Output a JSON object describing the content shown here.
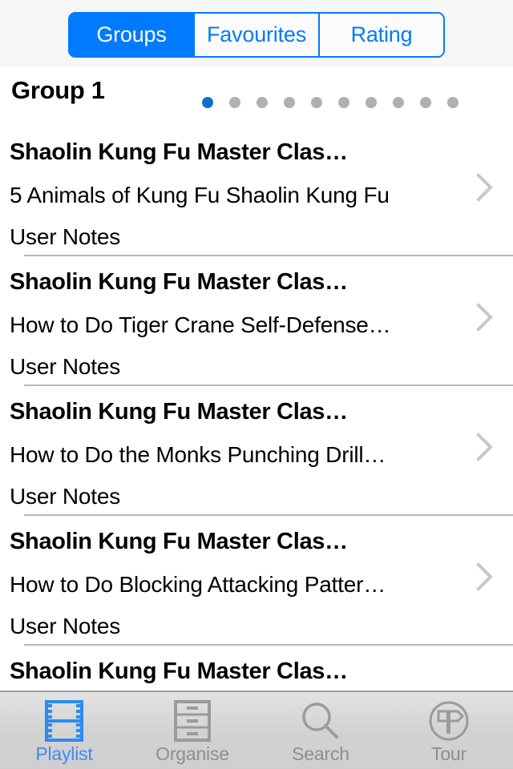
{
  "segmented_control": {
    "segments": [
      {
        "label": "Groups",
        "active": true
      },
      {
        "label": "Favourites",
        "active": false
      },
      {
        "label": "Rating",
        "active": false
      }
    ]
  },
  "group_header": {
    "title": "Group 1",
    "page_dots": {
      "total": 10,
      "active_index": 1
    }
  },
  "list": {
    "rows": [
      {
        "title": "Shaolin Kung Fu Master Clas…",
        "subtitle": "5 Animals of Kung Fu  Shaolin Kung Fu",
        "notes": "User Notes",
        "accessory": "chevron-right-icon"
      },
      {
        "title": "Shaolin Kung Fu Master Clas…",
        "subtitle": "How to Do Tiger  Crane Self-Defense…",
        "notes": "User Notes",
        "accessory": "chevron-right-icon"
      },
      {
        "title": "Shaolin Kung Fu Master Clas…",
        "subtitle": "How to Do the Monks Punching Drill…",
        "notes": "User Notes",
        "accessory": "chevron-right-icon"
      },
      {
        "title": "Shaolin Kung Fu Master Clas…",
        "subtitle": "How to Do Blocking  Attacking Patter…",
        "notes": "User Notes",
        "accessory": "chevron-right-icon"
      },
      {
        "title": "Shaolin Kung Fu Master Clas…",
        "subtitle": "",
        "notes": "",
        "accessory": ""
      }
    ]
  },
  "tab_bar": {
    "tabs": [
      {
        "label": "Playlist",
        "icon": "film-strip-icon",
        "active": true
      },
      {
        "label": "Organise",
        "icon": "file-cabinet-icon",
        "active": false
      },
      {
        "label": "Search",
        "icon": "magnifier-icon",
        "active": false
      },
      {
        "label": "Tour",
        "icon": "signpost-circle-icon",
        "active": false
      }
    ]
  },
  "colors": {
    "accent_blue": "#007aff",
    "tab_active_blue": "#3d8bef",
    "page_dot_active": "#0c6fd0",
    "page_dot_inactive": "#b0b0b0",
    "inactive_gray": "#8e8e8e",
    "separator": "#b8b8b8",
    "header_background": "#f7f7f7"
  }
}
